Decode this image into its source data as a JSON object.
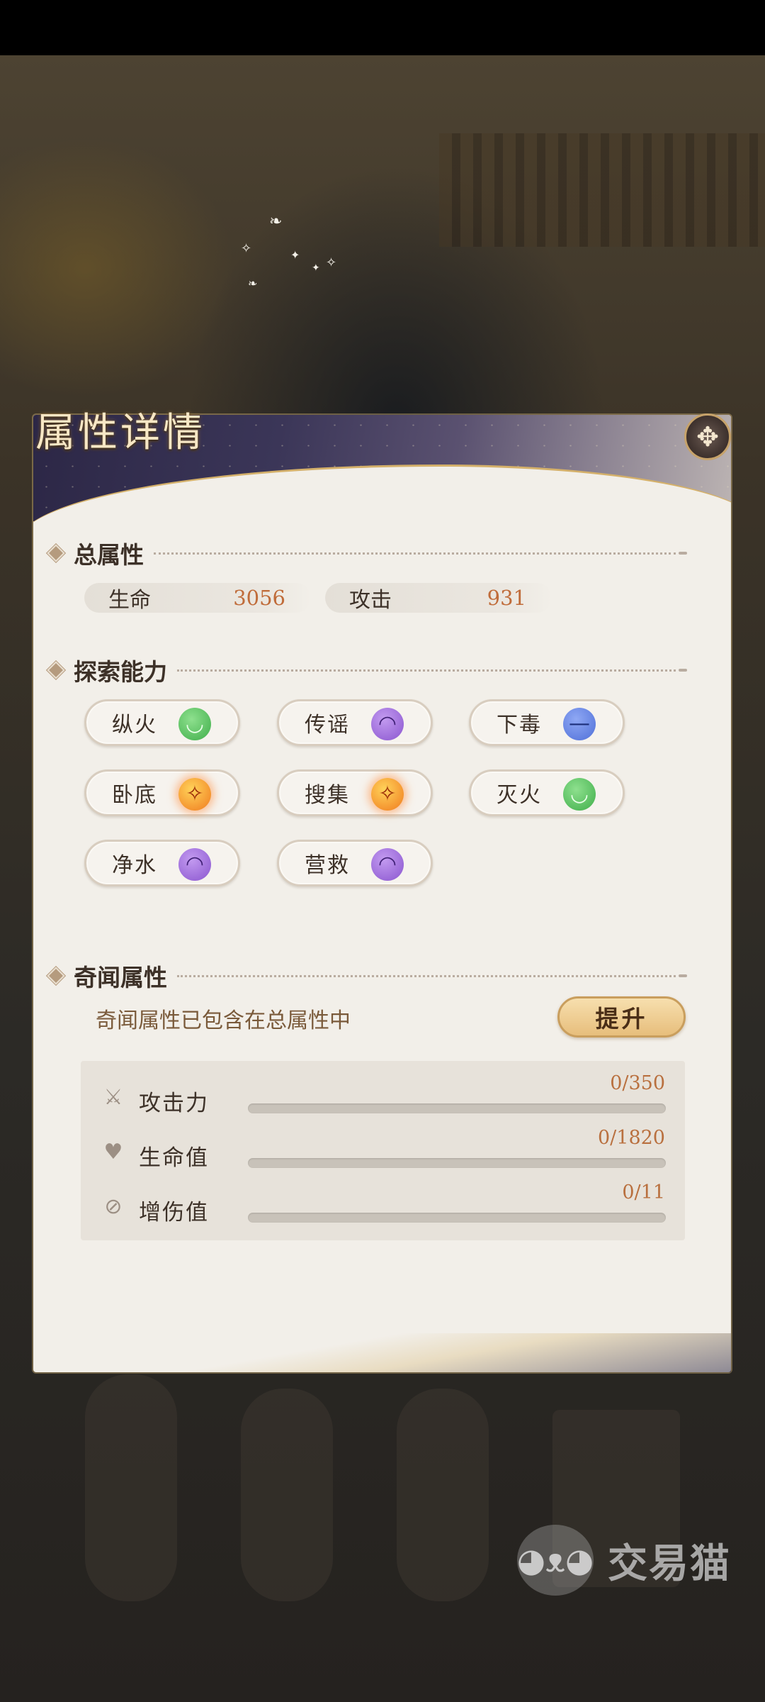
{
  "dialog": {
    "title": "属性详情",
    "close_icon": "close-ornament-icon"
  },
  "total_attributes": {
    "label": "总属性",
    "stats": [
      {
        "name": "生命",
        "value": "3056"
      },
      {
        "name": "攻击",
        "value": "931"
      }
    ]
  },
  "exploration": {
    "label": "探索能力",
    "abilities": [
      {
        "name": "纵火",
        "mood": "happy"
      },
      {
        "name": "传谣",
        "mood": "sad"
      },
      {
        "name": "下毒",
        "mood": "neutral"
      },
      {
        "name": "卧底",
        "mood": "excited"
      },
      {
        "name": "搜集",
        "mood": "excited"
      },
      {
        "name": "灭火",
        "mood": "happy"
      },
      {
        "name": "净水",
        "mood": "sad"
      },
      {
        "name": "营救",
        "mood": "sad"
      }
    ]
  },
  "qiwen": {
    "label": "奇闻属性",
    "note": "奇闻属性已包含在总属性中",
    "upgrade_label": "提升",
    "rows": [
      {
        "icon": "sword-icon",
        "label": "攻击力",
        "current": 0,
        "max": 350,
        "value_text": "0/350"
      },
      {
        "icon": "heart-plus-icon",
        "label": "生命值",
        "current": 0,
        "max": 1820,
        "value_text": "0/1820"
      },
      {
        "icon": "damage-boost-icon",
        "label": "增伤值",
        "current": 0,
        "max": 11,
        "value_text": "0/11"
      }
    ]
  },
  "watermark": {
    "text": "交易猫"
  },
  "colors": {
    "panel_bg": "#f2efe9",
    "accent_gold": "#c99e5d",
    "value_orange": "#c06c3a"
  }
}
